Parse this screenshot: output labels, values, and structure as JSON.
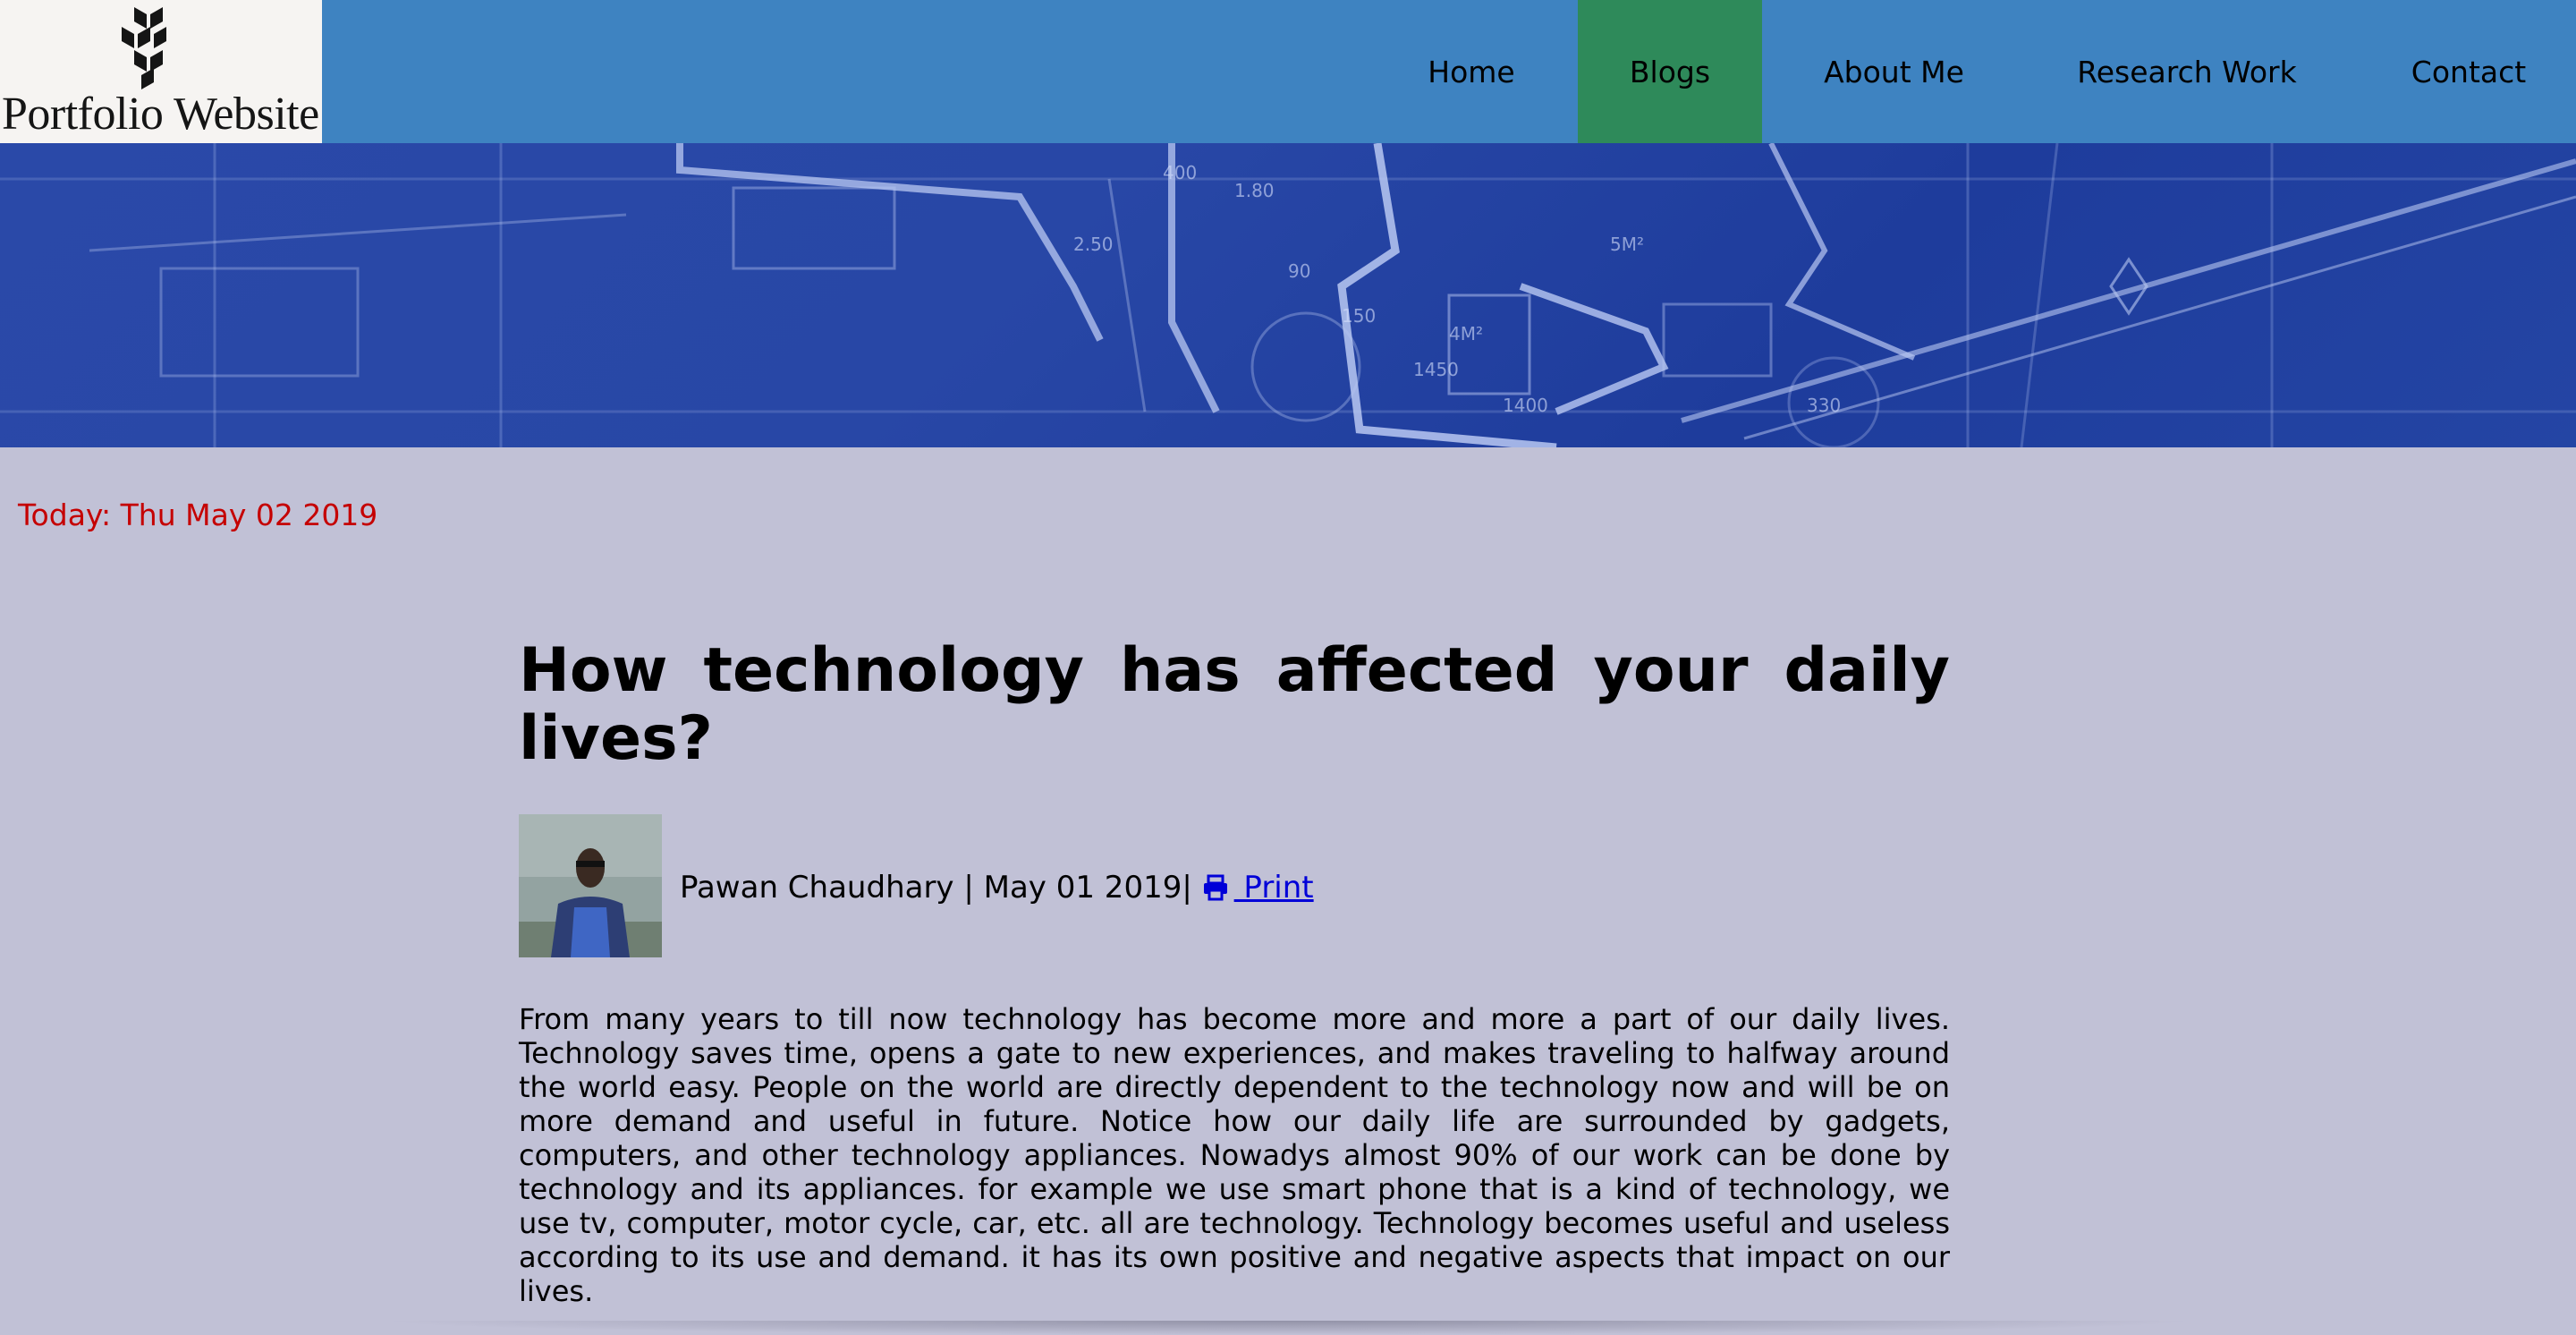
{
  "header": {
    "logo_text": "Portfolio Website",
    "nav": [
      {
        "label": "Home",
        "active": false
      },
      {
        "label": "Blogs",
        "active": true
      },
      {
        "label": "About Me",
        "active": false
      },
      {
        "label": "Research Work",
        "active": false
      },
      {
        "label": "Contact",
        "active": false
      }
    ]
  },
  "banner": {
    "labels": [
      "400",
      "1.80",
      "4M²",
      "150",
      "1450",
      "5M²",
      "1400",
      "2.50",
      "90",
      "330"
    ]
  },
  "today": "Today: Thu May 02 2019",
  "article": {
    "title": "How technology has affected your daily lives?",
    "author": "Pawan Chaudhary",
    "separator": " | ",
    "date": "May 01 2019",
    "date_separator": "| ",
    "print_label": " Print",
    "print_icon": "printer-icon",
    "body": "From many years to till now technology has become more and more a part of our daily lives. Technology saves time, opens a gate to new experiences, and makes traveling to halfway around the world easy. People on the world are directly dependent to the technology now and will be on more demand and useful in future. Notice how our daily life are surrounded by gadgets, computers, and other technology appliances. Nowadys almost 90% of our work can be done by technology and its appliances. for example we use smart phone that is a kind of technology, we use tv, computer, motor cycle, car, etc. all are technology. Technology becomes useful and useless according to its use and demand. it has its own positive and negative aspects that impact on our lives."
  },
  "colors": {
    "header_bg": "#3e83c1",
    "nav_active_bg": "#2e8a5a",
    "page_bg": "#c1c1d6",
    "date_color": "#c50000",
    "link_color": "#0000d8"
  }
}
